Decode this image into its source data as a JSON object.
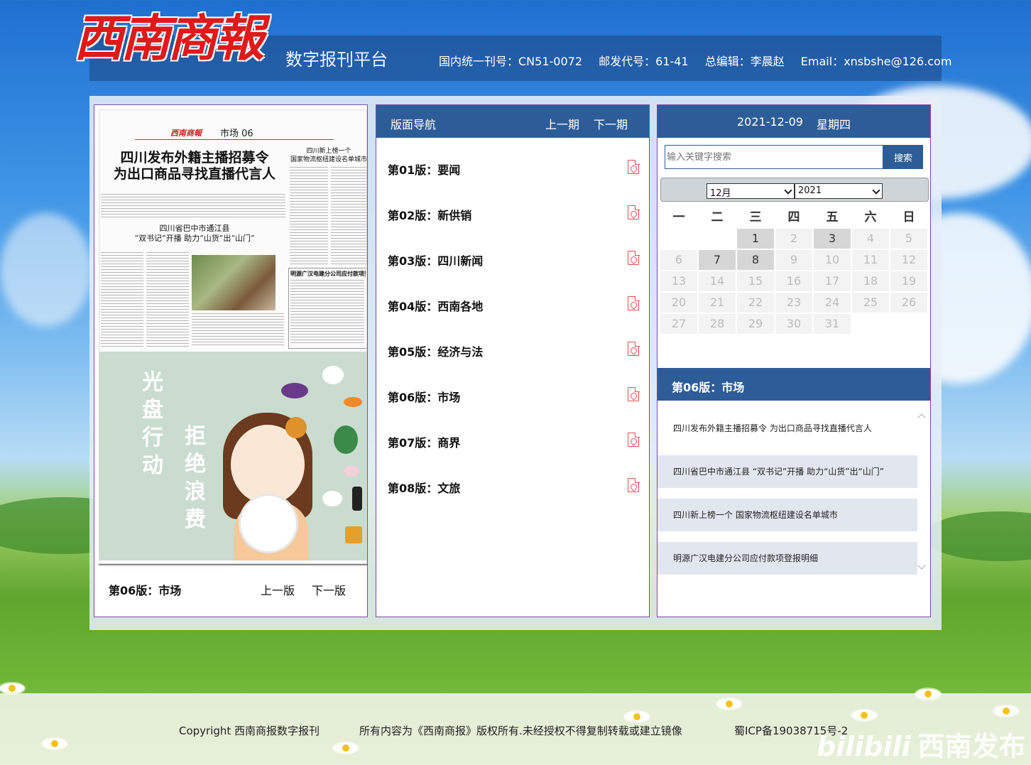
{
  "header": {
    "logo_text": "西南商報",
    "platform": "数字报刊平台",
    "info": [
      "国内统一刊号：CN51-0072",
      "邮发代号：61-41",
      "总编辑：李晨赵",
      "Email：xnsbshe@126.com"
    ]
  },
  "left": {
    "thumb": {
      "masthead_logo": "西南商報",
      "masthead_section": "市场 06",
      "headline_line1": "四川发布外籍主播招募令",
      "headline_line2": "为出口商品寻找直播代言人",
      "side_head_line1": "四川新上榜一个",
      "side_head_line2": "国家物流枢纽建设名单城市",
      "sub_head_line1": "四川省巴中市通江县",
      "sub_head_line2": "“双书记”开播 助力“山货”出“山门”",
      "side_box_title": "明源广汉电建分公司应付款项登报明细",
      "ad_col1": [
        "光",
        "盘",
        "行",
        "动"
      ],
      "ad_col2": [
        "拒",
        "绝",
        "浪",
        "费"
      ]
    },
    "current_page": "第06版：市场",
    "prev_label": "上一版",
    "next_label": "下一版"
  },
  "middle": {
    "title": "版面导航",
    "prev_issue": "上一期",
    "next_issue": "下一期",
    "pages": [
      "第01版：要闻",
      "第02版：新供销",
      "第03版：四川新闻",
      "第04版：西南各地",
      "第05版：经济与法",
      "第06版：市场",
      "第07版：商界",
      "第08版：文旅"
    ]
  },
  "right": {
    "date": "2021-12-09",
    "weekday": "星期四",
    "search_placeholder": "输入关键字搜索",
    "search_button": "搜索",
    "month_value": "12月",
    "year_value": "2021",
    "weekdays": [
      "一",
      "二",
      "三",
      "四",
      "五",
      "六",
      "日"
    ],
    "weeks": [
      [
        "",
        "",
        "1",
        "2",
        "3",
        "4",
        "5"
      ],
      [
        "6",
        "7",
        "8",
        "9",
        "10",
        "11",
        "12"
      ],
      [
        "13",
        "14",
        "15",
        "16",
        "17",
        "18",
        "19"
      ],
      [
        "20",
        "21",
        "22",
        "23",
        "24",
        "25",
        "26"
      ],
      [
        "27",
        "28",
        "29",
        "30",
        "31",
        "",
        ""
      ]
    ],
    "available_days": [
      "1",
      "3",
      "7",
      "8"
    ],
    "section_title": "第06版：市场",
    "articles": [
      "四川发布外籍主播招募令 为出口商品寻找直播代言人",
      "四川省巴中市通江县 “双书记”开播 助力“山货”出“山门”",
      "四川新上榜一个 国家物流枢纽建设名单城市",
      "明源广汉电建分公司应付款项登报明细"
    ]
  },
  "footer": {
    "copyright": "Copyright 西南商报数字报刊",
    "rights": "所有内容为《西南商报》版权所有.未经授权不得复制转载或建立镜像",
    "icp": "蜀ICP备19038715号-2",
    "watermark_brand": "bilibili",
    "watermark_text": "西南发布"
  },
  "colors": {
    "accent": "#2d5d98",
    "logo_red": "#e0191a",
    "panel_border": "#7b4aa8",
    "pdf_red": "#e05050"
  }
}
